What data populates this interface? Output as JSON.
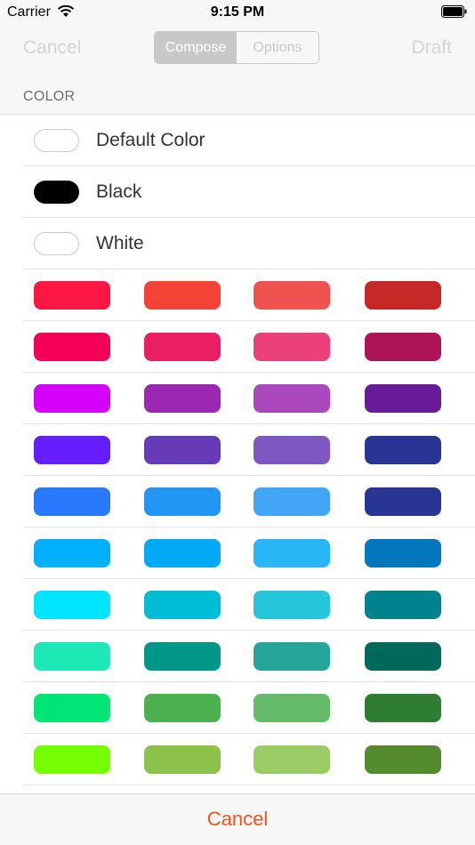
{
  "status_bar": {
    "carrier": "Carrier",
    "time": "9:15 PM"
  },
  "nav": {
    "cancel_label": "Cancel",
    "draft_label": "Draft",
    "segments": [
      "Compose",
      "Options"
    ],
    "selected_segment": "Compose"
  },
  "section": {
    "header": "COLOR"
  },
  "named_colors": [
    {
      "label": "Default Color",
      "color": "#ffffff",
      "outlined": true
    },
    {
      "label": "Black",
      "color": "#000000",
      "outlined": false
    },
    {
      "label": "White",
      "color": "#ffffff",
      "outlined": true
    }
  ],
  "palette": [
    [
      "#ff1744",
      "#f44336",
      "#ef5350",
      "#c62828"
    ],
    [
      "#f50057",
      "#e91e63",
      "#ec407a",
      "#ad1457"
    ],
    [
      "#d500f9",
      "#9c27b0",
      "#ab47bc",
      "#6a1b9a"
    ],
    [
      "#651fff",
      "#673ab7",
      "#7e57c2",
      "#283593"
    ],
    [
      "#2979ff",
      "#2196f3",
      "#42a5f5",
      "#283593"
    ],
    [
      "#00b0ff",
      "#03a9f4",
      "#29b6f6",
      "#0277bd"
    ],
    [
      "#00e5ff",
      "#00bcd4",
      "#26c6da",
      "#00838f"
    ],
    [
      "#1de9b6",
      "#009688",
      "#26a69a",
      "#00695c"
    ],
    [
      "#00e676",
      "#4caf50",
      "#66bb6a",
      "#2e7d32"
    ],
    [
      "#76ff03",
      "#8bc34a",
      "#9ccc65",
      "#558b2f"
    ]
  ],
  "footer": {
    "cancel_label": "Cancel"
  }
}
